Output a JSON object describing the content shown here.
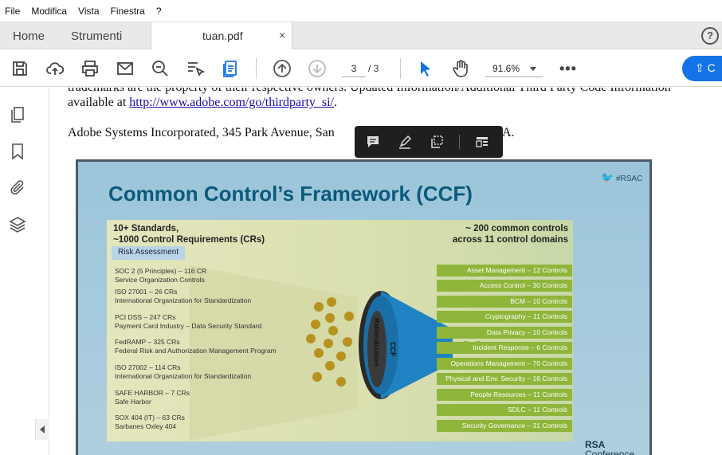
{
  "menu": [
    "File",
    "Modifica",
    "Vista",
    "Finestra",
    "?"
  ],
  "tabs": {
    "home": "Home",
    "tools": "Strumenti",
    "doc_name": "tuan.pdf",
    "close": "×"
  },
  "help": "?",
  "toolbar": {
    "page_current": "3",
    "page_total": "/ 3",
    "zoom": "91.6%",
    "more": "•••",
    "share": "C"
  },
  "document": {
    "line1": "trademarks are the property of their respective owners. Updated Information/Additional Third Party Code Information",
    "line2_prefix": "available at ",
    "line2_link": "http://www.adobe.com/go/thirdparty_si/",
    "line2_suffix": ".",
    "line3_a": "Adobe Systems Incorporated, 345 Park Avenue, San",
    "line3_b": "A."
  },
  "slide": {
    "title": "Common Control’s Framework (CCF)",
    "hashtag": "#RSAC",
    "left_head_1": "10+ Standards,",
    "left_head_2": "~1000 Control Requirements (CRs)",
    "right_head_1": "~ 200 common controls",
    "right_head_2": "across 11 control domains",
    "risk_label": "Risk Assessment",
    "funnel_label": "CCF",
    "funnel_sub": "Rationalization",
    "standards": [
      {
        "name": "SOC 2 (5 Principles) – 116 CR",
        "desc": "Service Organization Controls"
      },
      {
        "name": "ISO 27001 – 26 CRs",
        "desc": "International Organization for Standardization"
      },
      {
        "name": "PCI DSS – 247 CRs",
        "desc": "Payment Card Industry – Data Security Standard"
      },
      {
        "name": "FedRAMP – 325 CRs",
        "desc": "Federal Risk and Authorization Management Program"
      },
      {
        "name": "ISO 27002 – 114 CRs",
        "desc": "International Organization for Standardization"
      },
      {
        "name": "SAFE HARBOR – 7 CRs",
        "desc": "Safe Harbor"
      },
      {
        "name": "SOX 404 (IT) – 63 CRs",
        "desc": "Sarbanes Oxley 404"
      }
    ],
    "controls": [
      "Asset Management – 12 Controls",
      "Access Control – 30 Controls",
      "BCM – 10 Controls",
      "Cryptography – 11 Controls",
      "Data Privacy – 10 Controls",
      "Incident Response – 6 Controls",
      "Operations Management – 70 Controls",
      "Physical and Env. Security – 16 Controls",
      "People Resources – 11 Controls",
      "SDLC – 11 Controls",
      "Security Governance – 31 Controls"
    ],
    "rsa_1": "RSA",
    "rsa_2": "Conference"
  },
  "colors": {
    "accent": "#1473e6",
    "slide_title": "#0b5a7a",
    "control_bar": "#8fb53a",
    "funnel": "#1a6fa8"
  }
}
